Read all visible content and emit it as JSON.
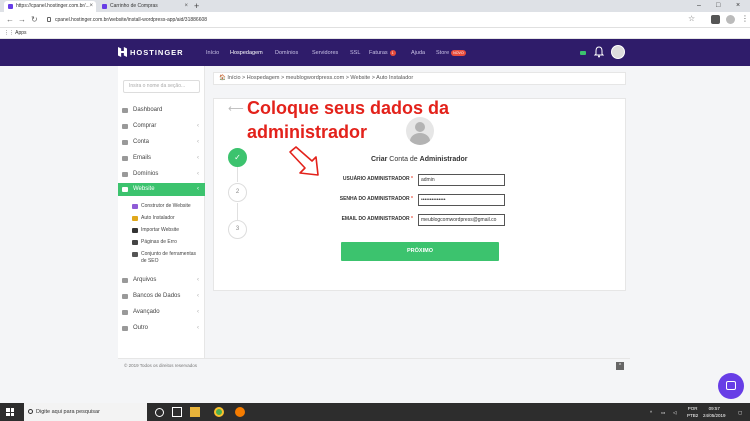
{
  "browser": {
    "tabs": [
      {
        "label": "https://cpanel.hostinger.com.br/..."
      },
      {
        "label": "Carrinho de Compras"
      }
    ],
    "url": "cpanel.hostinger.com.br/website/install-wordpress-app/aid/31886608",
    "bookmarks_label": "Apps"
  },
  "header": {
    "logo": "HOSTINGER",
    "nav": [
      {
        "label": "Início"
      },
      {
        "label": "Hospedagem"
      },
      {
        "label": "Domínios"
      },
      {
        "label": "Servidores"
      },
      {
        "label": "SSL"
      },
      {
        "label": "Faturas",
        "badge": "1"
      },
      {
        "label": "Ajuda"
      },
      {
        "label": "Store",
        "badge": "NOVO"
      }
    ]
  },
  "sidebar": {
    "search_placeholder": "Insira o nome da seção...",
    "items": [
      {
        "label": "Dashboard"
      },
      {
        "label": "Comprar"
      },
      {
        "label": "Conta"
      },
      {
        "label": "Emails"
      },
      {
        "label": "Domínios"
      },
      {
        "label": "Website"
      },
      {
        "label": "Arquivos"
      },
      {
        "label": "Bancos de Dados"
      },
      {
        "label": "Avançado"
      },
      {
        "label": "Outro"
      }
    ],
    "sub_items": [
      {
        "label": "Construtor de Website"
      },
      {
        "label": "Auto Instalador"
      },
      {
        "label": "Importar Website"
      },
      {
        "label": "Páginas de Erro"
      },
      {
        "label": "Conjunto de ferramentas de SEO"
      }
    ]
  },
  "breadcrumb": "🏠 Início  >  Hospedagem  >  meublogwordpress.com  >  Website  >  Auto Instalador",
  "form": {
    "title_bold1": "Criar",
    "title_mid": " Conta de ",
    "title_bold2": "Administrador",
    "steps": [
      "2",
      "3"
    ],
    "fields": [
      {
        "label": "USUÁRIO ADMINISTRADOR",
        "value": "admin"
      },
      {
        "label": "SENHA DO ADMINISTRADOR",
        "value": "••••••••••••••"
      },
      {
        "label": "EMAIL DO ADMINISTRADOR",
        "value": "meublogcomwordpress@gmail.co"
      }
    ],
    "submit": "PRÓXIMO"
  },
  "annotation": "Coloque seus dados da administrador",
  "footer": "© 2019 Todos os direitos reservados",
  "taskbar": {
    "search": "Digite aqui para pesquisar",
    "lang1": "POR",
    "lang2": "PTB2",
    "time": "09:57",
    "date": "24/05/2019"
  },
  "colors": {
    "header_bg": "#2f1c6a",
    "accent_green": "#3cc36e",
    "annotation_red": "#e3221b",
    "chat_purple": "#673de6"
  }
}
